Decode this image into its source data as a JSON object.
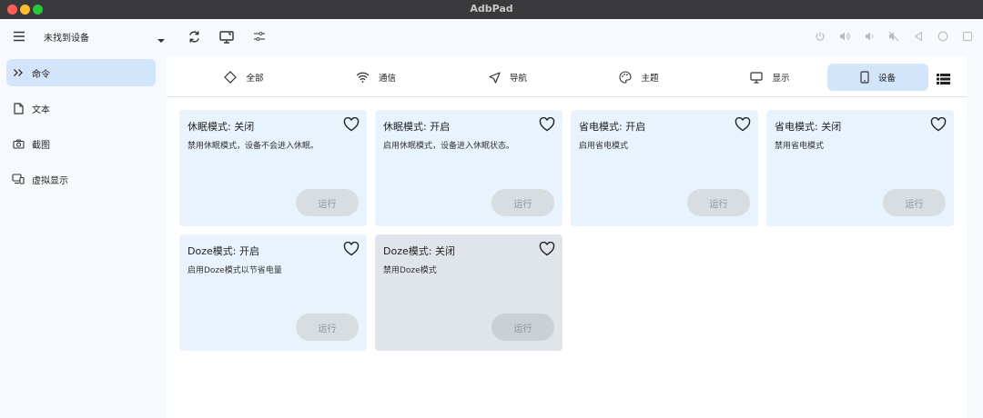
{
  "app": {
    "title": "AdbPad"
  },
  "toolbar": {
    "device_label": "未找到设备",
    "icons": [
      "menu-icon",
      "refresh-icon",
      "screen-mirror-icon",
      "settings-sliders-icon",
      "power-icon",
      "volume-up-icon",
      "volume-down-icon",
      "volume-mute-icon",
      "back-icon",
      "home-icon",
      "overview-icon"
    ]
  },
  "sidebar": {
    "items": [
      {
        "label": "命令",
        "icon": "chevrons-right-icon",
        "active": true
      },
      {
        "label": "文本",
        "icon": "document-icon",
        "active": false
      },
      {
        "label": "截图",
        "icon": "camera-icon",
        "active": false
      },
      {
        "label": "虚拟显示",
        "icon": "virtual-display-icon",
        "active": false
      }
    ]
  },
  "tabs": [
    {
      "label": "全部",
      "icon": "diamond-icon",
      "active": false
    },
    {
      "label": "通信",
      "icon": "wifi-icon",
      "active": false
    },
    {
      "label": "导航",
      "icon": "navigation-icon",
      "active": false
    },
    {
      "label": "主题",
      "icon": "palette-icon",
      "active": false
    },
    {
      "label": "显示",
      "icon": "monitor-icon",
      "active": false
    },
    {
      "label": "设备",
      "icon": "phone-icon",
      "active": true
    }
  ],
  "cards": [
    {
      "title": "休眠模式: 关闭",
      "desc": "禁用休眠模式，设备不会进入休眠。",
      "button": "运行"
    },
    {
      "title": "休眠模式: 开启",
      "desc": "启用休眠模式，设备进入休眠状态。",
      "button": "运行"
    },
    {
      "title": "省电模式: 开启",
      "desc": "启用省电模式",
      "button": "运行"
    },
    {
      "title": "省电模式: 关闭",
      "desc": "禁用省电模式",
      "button": "运行"
    },
    {
      "title": "Doze模式: 开启",
      "desc": "启用Doze模式以节省电量",
      "button": "运行"
    },
    {
      "title": "Doze模式: 关闭",
      "desc": "禁用Doze模式",
      "button": "运行"
    }
  ],
  "colors": {
    "accent_bg": "#d3e5fa",
    "card_bg": "#e9f3fd",
    "titlebar": "#3a3a3c"
  }
}
